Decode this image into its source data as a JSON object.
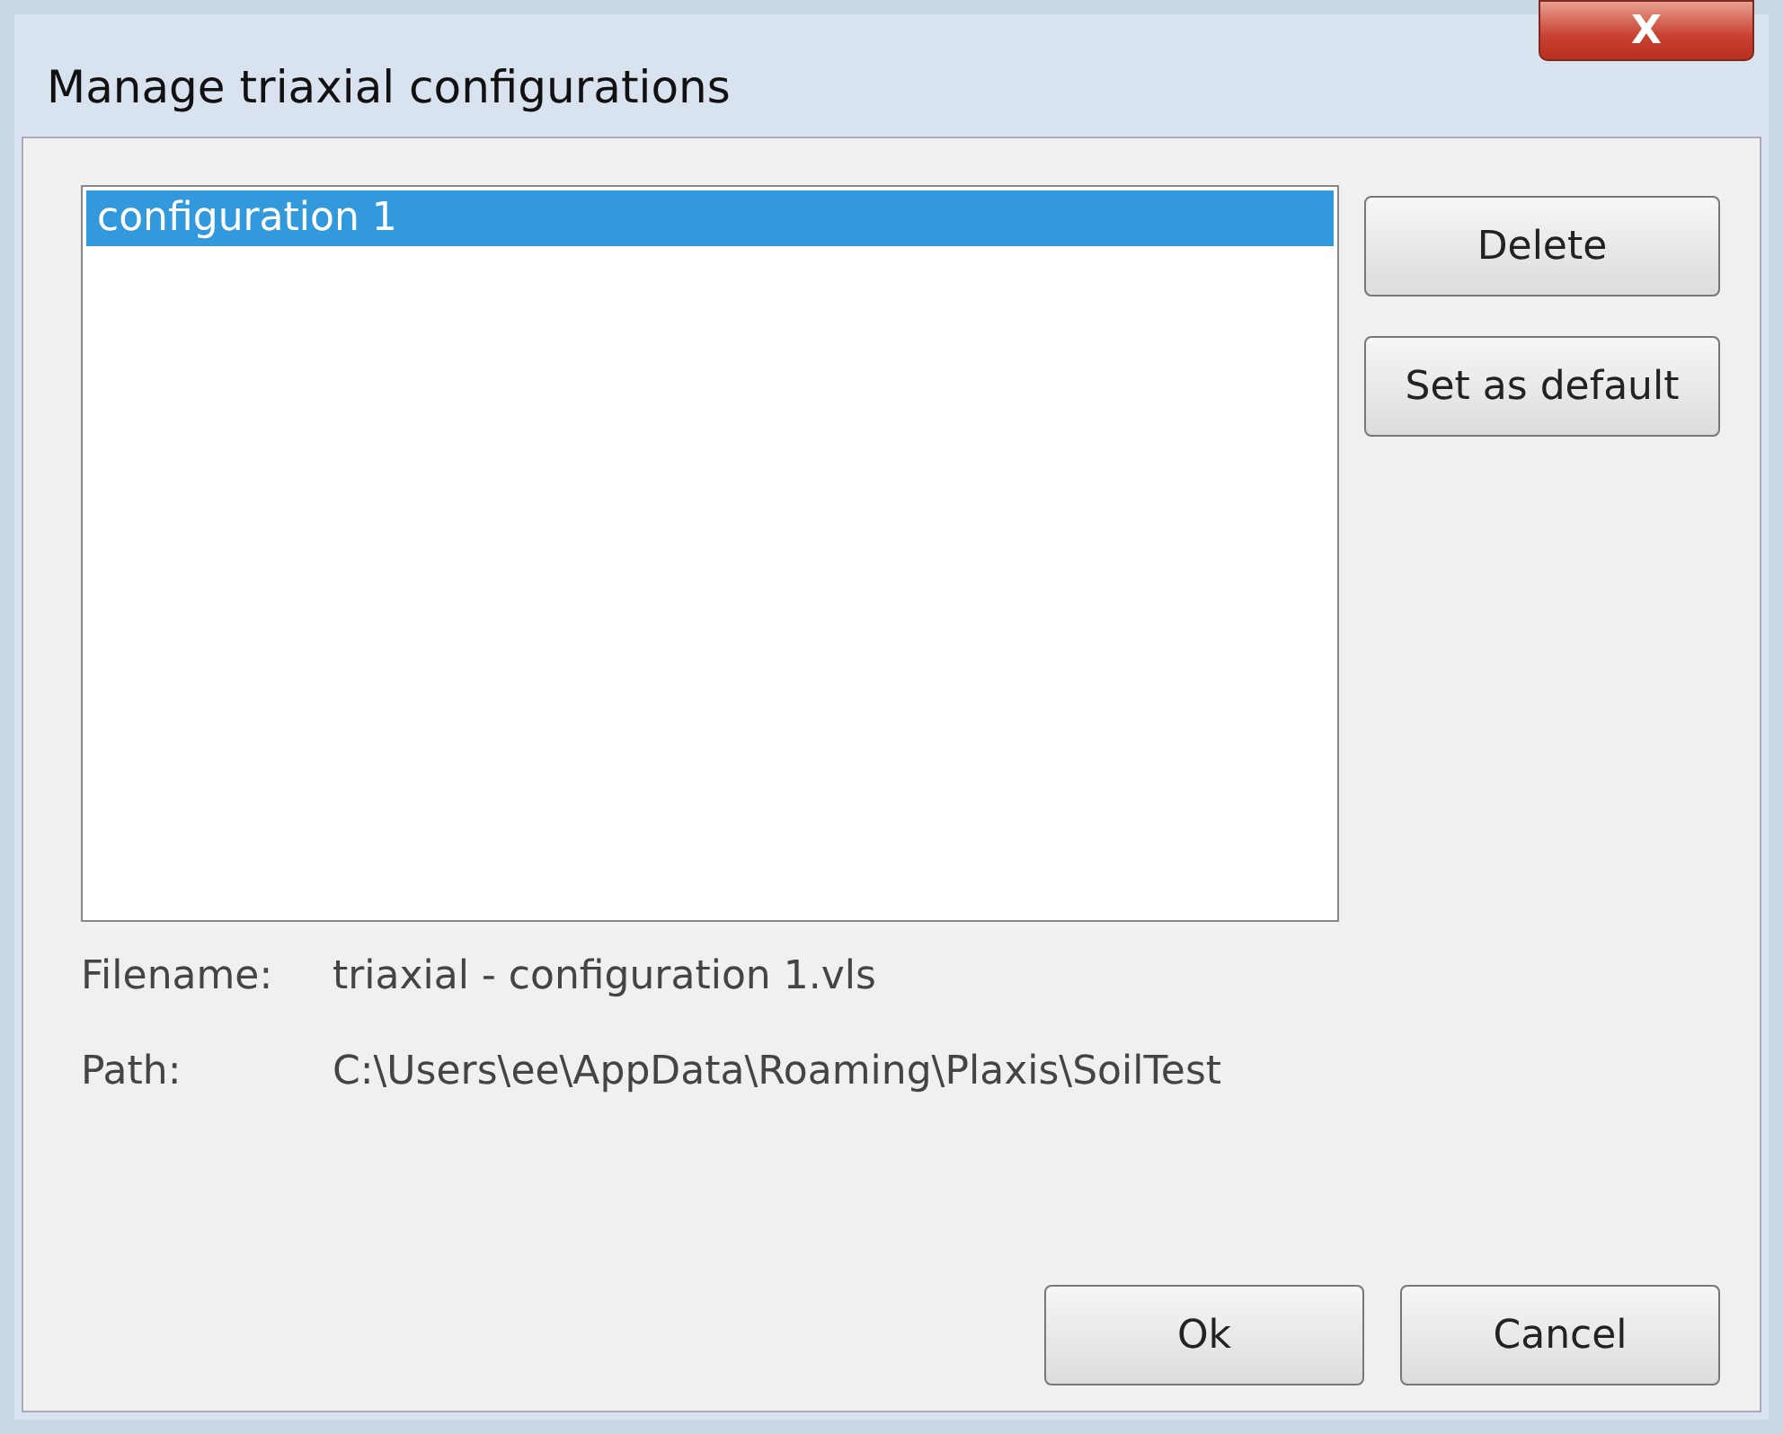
{
  "window": {
    "title": "Manage triaxial configurations",
    "close": "X"
  },
  "configurations": [
    {
      "label": "configuration 1",
      "selected": true
    }
  ],
  "side_buttons": [
    "Delete",
    "Set as default"
  ],
  "details": [
    {
      "label": "Filename:",
      "value": "triaxial - configuration 1.vls"
    },
    {
      "label": "Path:",
      "value": "C:\\Users\\ee\\AppData\\Roaming\\Plaxis\\SoilTest"
    }
  ],
  "buttons": [
    "Ok",
    "Cancel"
  ]
}
